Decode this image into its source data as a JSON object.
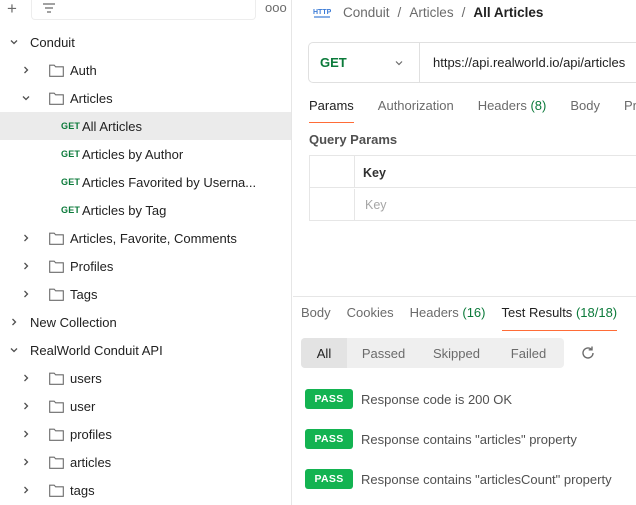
{
  "sidebar": {
    "rows": [
      {
        "type": "collection",
        "label": "Conduit",
        "expanded": true
      },
      {
        "type": "folder",
        "label": "Auth",
        "expanded": false
      },
      {
        "type": "folder",
        "label": "Articles",
        "expanded": true
      },
      {
        "type": "request",
        "method": "GET",
        "label": "All Articles",
        "selected": true
      },
      {
        "type": "request",
        "method": "GET",
        "label": "Articles by Author"
      },
      {
        "type": "request",
        "method": "GET",
        "label": "Articles Favorited by Userna..."
      },
      {
        "type": "request",
        "method": "GET",
        "label": "Articles by Tag"
      },
      {
        "type": "folder",
        "label": "Articles, Favorite, Comments",
        "expanded": false
      },
      {
        "type": "folder",
        "label": "Profiles",
        "expanded": false
      },
      {
        "type": "folder",
        "label": "Tags",
        "expanded": false
      },
      {
        "type": "collection",
        "label": "New Collection",
        "expanded": false
      },
      {
        "type": "collection",
        "label": "RealWorld Conduit API",
        "expanded": true
      },
      {
        "type": "folder",
        "label": "users",
        "expanded": false
      },
      {
        "type": "folder",
        "label": "user",
        "expanded": false
      },
      {
        "type": "folder",
        "label": "profiles",
        "expanded": false
      },
      {
        "type": "folder",
        "label": "articles",
        "expanded": false
      },
      {
        "type": "folder",
        "label": "tags",
        "expanded": false
      }
    ],
    "more_label": "ooo",
    "add_label": "+"
  },
  "breadcrumb": {
    "icon": "http-icon",
    "items": [
      "Conduit",
      "Articles"
    ],
    "current": "All Articles",
    "separator": "/"
  },
  "request": {
    "method": "GET",
    "url": "https://api.realworld.io/api/articles"
  },
  "request_tabs": [
    {
      "label": "Params",
      "active": true
    },
    {
      "label": "Authorization"
    },
    {
      "label": "Headers",
      "count": "(8)"
    },
    {
      "label": "Body"
    },
    {
      "label": "Pr"
    }
  ],
  "query_params": {
    "title": "Query Params",
    "key_header": "Key",
    "key_placeholder": "Key"
  },
  "response_tabs": [
    {
      "label": "Body"
    },
    {
      "label": "Cookies"
    },
    {
      "label": "Headers",
      "count": "(16)"
    },
    {
      "label": "Test Results",
      "count": "(18/18)",
      "active": true
    }
  ],
  "result_filters": [
    {
      "label": "All",
      "active": true
    },
    {
      "label": "Passed"
    },
    {
      "label": "Skipped"
    },
    {
      "label": "Failed"
    }
  ],
  "test_results": [
    {
      "status": "PASS",
      "text": "Response code is 200 OK"
    },
    {
      "status": "PASS",
      "text": "Response contains \"articles\" property"
    },
    {
      "status": "PASS",
      "text": "Response contains \"articlesCount\" property"
    }
  ],
  "colors": {
    "get_method": "#0b7a3a",
    "pass_badge": "#13b351",
    "active_tab_underline": "#ff6c37",
    "selected_row": "#ebebeb"
  }
}
